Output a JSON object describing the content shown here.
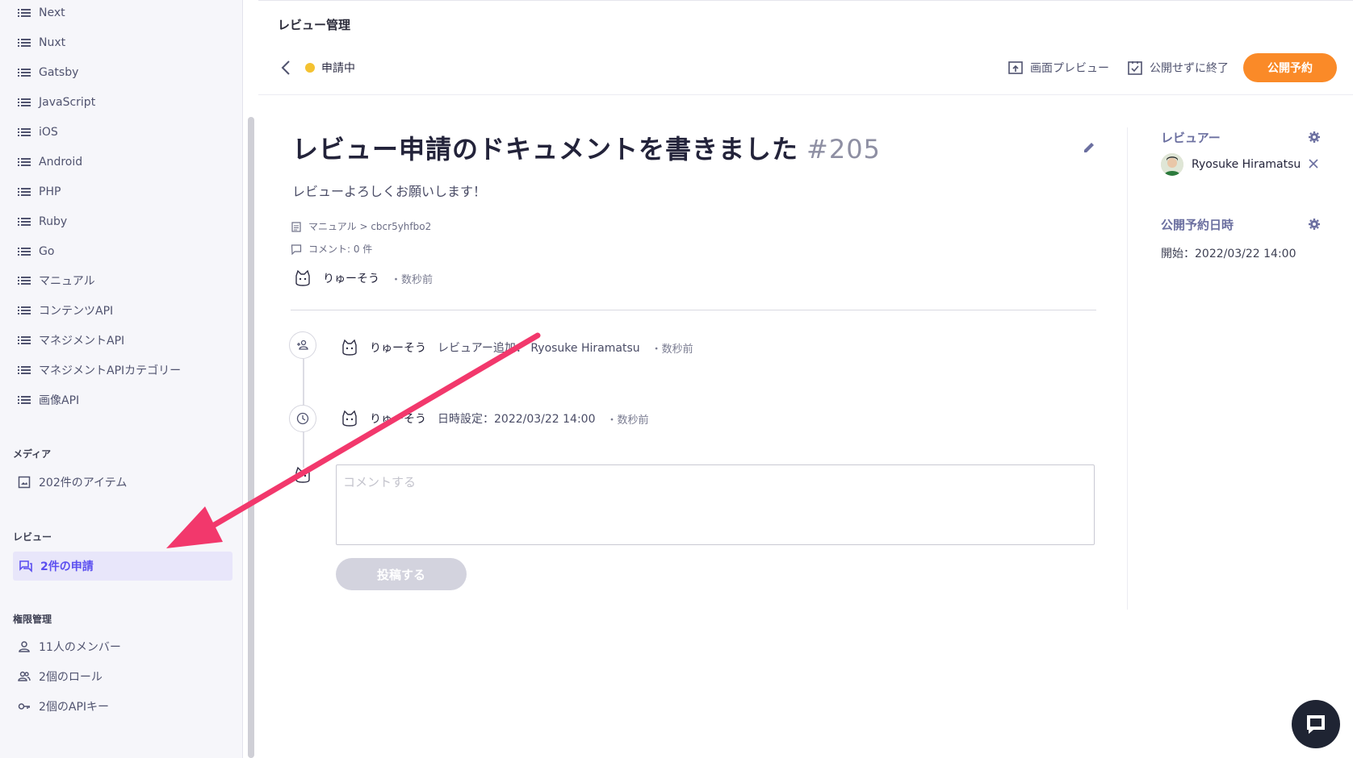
{
  "sidebar": {
    "items": [
      {
        "label": "Next",
        "icon": "list-icon"
      },
      {
        "label": "Nuxt",
        "icon": "list-icon"
      },
      {
        "label": "Gatsby",
        "icon": "list-icon"
      },
      {
        "label": "JavaScript",
        "icon": "list-icon"
      },
      {
        "label": "iOS",
        "icon": "list-icon"
      },
      {
        "label": "Android",
        "icon": "list-icon"
      },
      {
        "label": "PHP",
        "icon": "list-icon"
      },
      {
        "label": "Ruby",
        "icon": "list-icon"
      },
      {
        "label": "Go",
        "icon": "list-icon"
      },
      {
        "label": "マニュアル",
        "icon": "list-icon"
      },
      {
        "label": "コンテンツAPI",
        "icon": "list-icon"
      },
      {
        "label": "マネジメントAPI",
        "icon": "list-icon"
      },
      {
        "label": "マネジメントAPIカテゴリー",
        "icon": "list-icon"
      },
      {
        "label": "画像API",
        "icon": "list-icon"
      }
    ],
    "media_section": "メディア",
    "media_item": "202件のアイテム",
    "review_section": "レビュー",
    "review_item": "2件の申請",
    "permission_section": "権限管理",
    "permission_items": [
      {
        "label": "11人のメンバー",
        "icon": "person-icon"
      },
      {
        "label": "2個のロール",
        "icon": "people-icon"
      },
      {
        "label": "2個のAPIキー",
        "icon": "key-icon"
      }
    ]
  },
  "header": {
    "title": "レビュー管理",
    "status": "申請中",
    "status_color": "#f4c231",
    "preview_label": "画面プレビュー",
    "end_label": "公開せずに終了",
    "publish_label": "公開予約",
    "publish_color": "#fa8a28"
  },
  "document": {
    "title": "レビュー申請のドキュメントを書きました",
    "number": "#205",
    "description": "レビューよろしくお願いします！",
    "path": "マニュアル > cbcr5yhfbo2",
    "comments": "コメント: 0 件",
    "author": "りゅーそう",
    "time": "・数秒前"
  },
  "timeline": [
    {
      "icon": "add-person-icon",
      "author": "りゅーそう",
      "text": "レビュアー追加： Ryosuke Hiramatsu",
      "time": "・数秒前"
    },
    {
      "icon": "clock-icon",
      "author": "りゅーそう",
      "text": "日時設定：2022/03/22 14:00",
      "time": "・数秒前"
    }
  ],
  "comment": {
    "placeholder": "コメントする",
    "submit_label": "投稿する"
  },
  "right_panel": {
    "reviewer_heading": "レビュアー",
    "reviewer_name": "Ryosuke Hiramatsu",
    "schedule_heading": "公開予約日時",
    "schedule_value": "開始：2022/03/22 14:00"
  },
  "colors": {
    "accent": "#5b4ff0",
    "arrow": "#f2386c"
  }
}
